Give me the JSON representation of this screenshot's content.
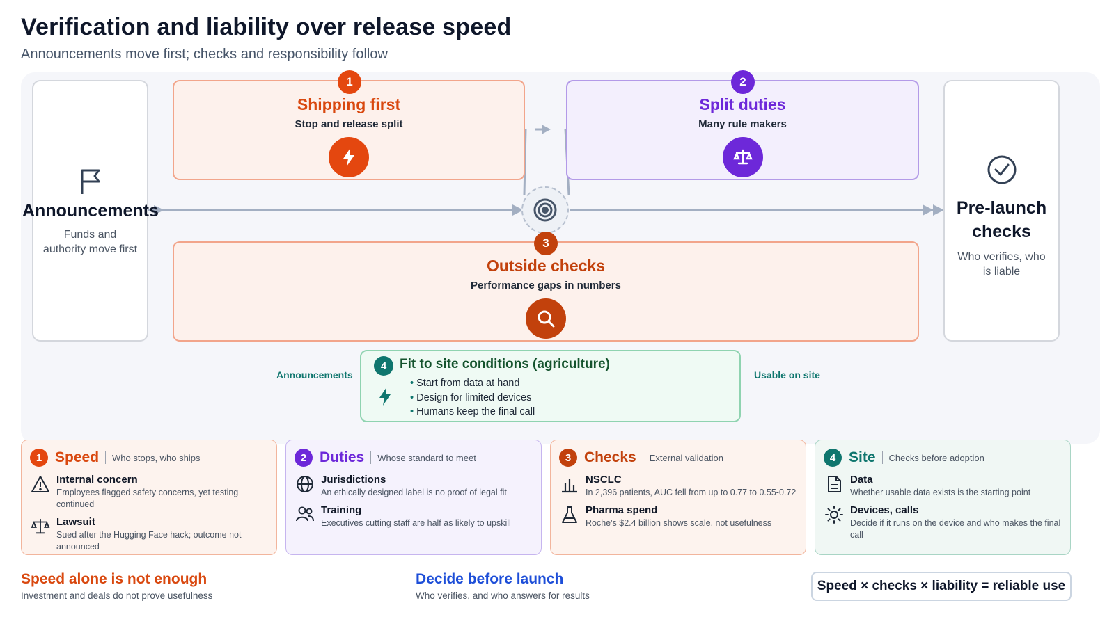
{
  "title": "Verification and liability over release speed",
  "subtitle": "Announcements move first; checks and responsibility follow",
  "flow": {
    "start": {
      "title": "Announcements",
      "sub": "Funds and authority move first",
      "icon": "flag-icon"
    },
    "end": {
      "title": "Pre-launch checks",
      "sub": "Who verifies, who is liable",
      "icon": "check-circle-icon"
    },
    "hub_icon": "target-icon",
    "stages": [
      {
        "num": "1",
        "title": "Shipping first",
        "sub": "Stop and release split",
        "icon": "lightning-icon",
        "color": "#d9480f",
        "fill": "#fdf1ec",
        "border": "#f2a58b"
      },
      {
        "num": "2",
        "title": "Split duties",
        "sub": "Many rule makers",
        "icon": "scales-icon",
        "color": "#6d28d9",
        "fill": "#f3effd",
        "border": "#b39ae8"
      },
      {
        "num": "3",
        "title": "Outside checks",
        "sub": "Performance gaps in numbers",
        "icon": "magnifier-icon",
        "color": "#c2410c",
        "fill": "#fdf1ec",
        "border": "#f2a58b"
      }
    ],
    "site": {
      "num": "4",
      "title": "Fit to site conditions (agriculture)",
      "left_label": "Announcements",
      "right_label": "Usable on site",
      "bullets": [
        "Start from data at hand",
        "Design for limited devices",
        "Humans keep the final call"
      ],
      "color": "#0f766e"
    }
  },
  "cards": [
    {
      "num": "1",
      "title": "Speed",
      "tag": "Who stops, who ships",
      "color": "#d9480f",
      "fill": "#fdf3ee",
      "border": "#f2b59d",
      "rows": [
        {
          "icon": "warning-icon",
          "title": "Internal concern",
          "text": "Employees flagged safety concerns, yet testing continued"
        },
        {
          "icon": "scales-icon",
          "title": "Lawsuit",
          "text": "Sued after the Hugging Face hack; outcome not announced"
        }
      ]
    },
    {
      "num": "2",
      "title": "Duties",
      "tag": "Whose standard to meet",
      "color": "#6d28d9",
      "fill": "#f5f2fd",
      "border": "#c6b5ef",
      "rows": [
        {
          "icon": "globe-icon",
          "title": "Jurisdictions",
          "text": "An ethically designed label is no proof of legal fit"
        },
        {
          "icon": "people-icon",
          "title": "Training",
          "text": "Executives cutting staff are half as likely to upskill"
        }
      ]
    },
    {
      "num": "3",
      "title": "Checks",
      "tag": "External validation",
      "color": "#c2410c",
      "fill": "#fdf3ee",
      "border": "#f2b59d",
      "rows": [
        {
          "icon": "bar-chart-icon",
          "title": "NSCLC",
          "text": "In 2,396 patients, AUC fell from up to 0.77 to 0.55-0.72"
        },
        {
          "icon": "flask-icon",
          "title": "Pharma spend",
          "text": "Roche's $2.4 billion shows scale, not usefulness"
        }
      ]
    },
    {
      "num": "4",
      "title": "Site",
      "tag": "Checks before adoption",
      "color": "#0f766e",
      "fill": "#f0f7f4",
      "border": "#a9d5c5",
      "rows": [
        {
          "icon": "document-icon",
          "title": "Data",
          "text": "Whether usable data exists is the starting point"
        },
        {
          "icon": "sun-icon",
          "title": "Devices, calls",
          "text": "Decide if it runs on the device and who makes the final call"
        }
      ]
    }
  ],
  "footer": {
    "left": {
      "title": "Speed alone is not enough",
      "sub": "Investment and deals do not prove usefulness",
      "color": "#d9480f"
    },
    "mid": {
      "title": "Decide before launch",
      "sub": "Who verifies, and who answers for results",
      "color": "#1d4ed8"
    },
    "formula": "Speed × checks × liability = reliable use"
  }
}
